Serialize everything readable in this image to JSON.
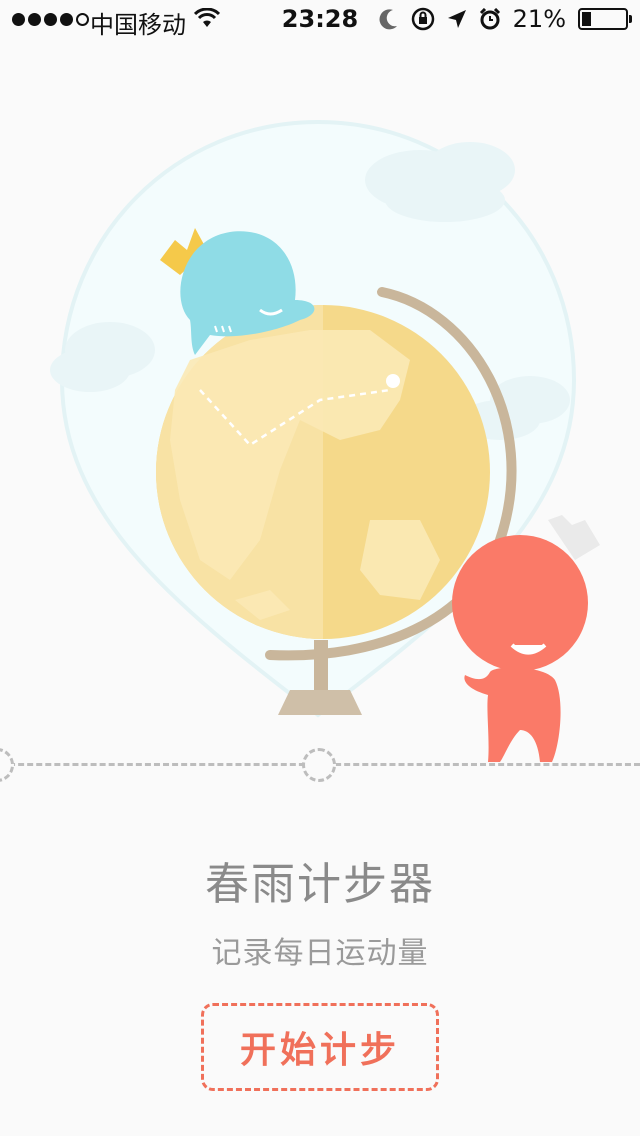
{
  "status_bar": {
    "carrier": "中国移动",
    "time": "23:28",
    "battery_percent": "21%",
    "battery_level": 0.21,
    "icons": [
      "signal-dots-icon",
      "wifi-icon",
      "moon-icon",
      "rotation-lock-icon",
      "location-arrow-icon",
      "alarm-icon",
      "battery-icon"
    ]
  },
  "hero": {
    "title": "春雨计步器",
    "subtitle": "记录每日运动量"
  },
  "actions": {
    "start_label": "开始计步"
  },
  "colors": {
    "accent": "#f0705a",
    "globe": "#f5d98a",
    "blue_character": "#8fdce6",
    "red_character": "#fa7a68",
    "track": "#bdbdbd"
  }
}
